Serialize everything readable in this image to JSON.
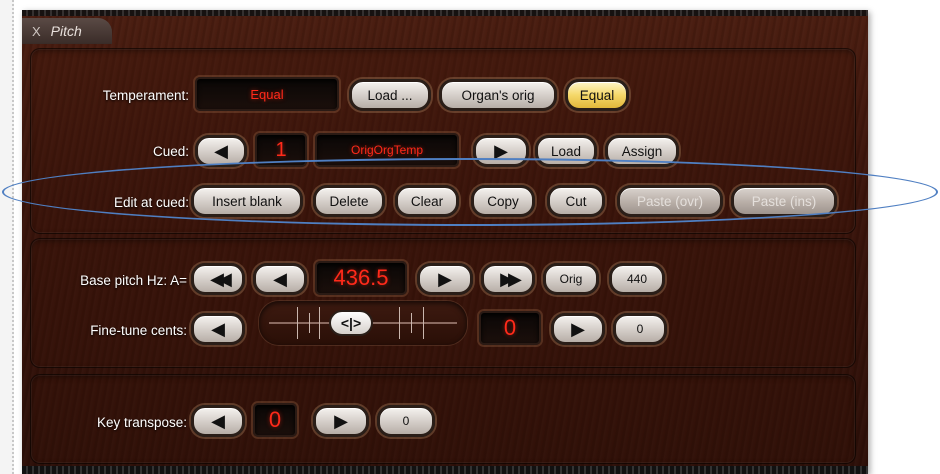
{
  "tab": {
    "close_label": "X",
    "title": "Pitch"
  },
  "temperament": {
    "label": "Temperament:",
    "display": "Equal",
    "load_label": "Load ...",
    "organs_orig_label": "Organ's orig",
    "equal_label": "Equal"
  },
  "cued": {
    "label": "Cued:",
    "number": "1",
    "name": "OrigOrgTemp",
    "load_label": "Load",
    "assign_label": "Assign"
  },
  "edit": {
    "label": "Edit at cued:",
    "insert_blank": "Insert blank",
    "delete": "Delete",
    "clear": "Clear",
    "copy": "Copy",
    "cut": "Cut",
    "paste_ovr": "Paste (ovr)",
    "paste_ins": "Paste (ins)"
  },
  "base_pitch": {
    "label": "Base pitch Hz: A=",
    "value": "436.5",
    "orig_label": "Orig",
    "preset_label": "440"
  },
  "fine_tune": {
    "label": "Fine-tune cents:",
    "value": "0",
    "reset_label": "0"
  },
  "key_transpose": {
    "label": "Key transpose:",
    "value": "0",
    "reset_label": "0"
  },
  "icons": {
    "left": "◀",
    "right": "▶",
    "double_left": "◀◀",
    "double_right": "▶▶",
    "knob": "<|>"
  },
  "colors": {
    "display_text": "#ff2a1a",
    "highlight_ellipse": "#4f7fc2",
    "active_button": "#f5d86a"
  }
}
